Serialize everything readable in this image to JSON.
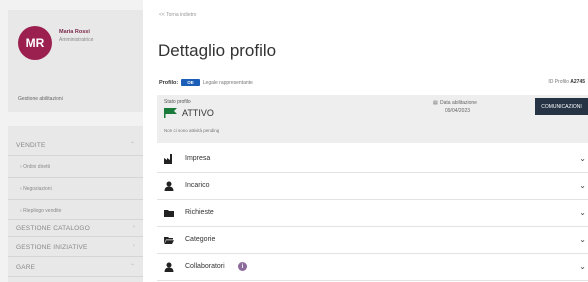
{
  "sidebar": {
    "user": {
      "initials": "MR",
      "name": "Maria Rossi",
      "role": "Amministratrice"
    },
    "card_link": "Gestione abilitazioni",
    "menu": [
      {
        "label": "VENDITE",
        "type": "section",
        "expanded": true
      },
      {
        "label": "Ordini diretti",
        "type": "sub"
      },
      {
        "label": "Negoziazioni",
        "type": "sub"
      },
      {
        "label": "Riepilogo vendite",
        "type": "sub"
      },
      {
        "label": "GESTIONE CATALOGO",
        "type": "section",
        "expanded": false
      },
      {
        "label": "GESTIONE INIZIATIVE",
        "type": "section",
        "expanded": false
      },
      {
        "label": "GARE",
        "type": "section",
        "expanded": true
      }
    ]
  },
  "main": {
    "breadcrumb": "<< Torna indietro",
    "title": "Dettaglio profilo",
    "profile_label": "Profilo:",
    "profile_badge": "OE",
    "profile_link": "Legale rappresentante",
    "profile_id_label": "ID Profilo",
    "profile_id_value": "A2745",
    "status": {
      "label": "Stato profilo",
      "value": "ATTIVO",
      "note": "Non ci sono attività pending",
      "enable_label": "Data abilitazione",
      "enable_date": "09/04/2023",
      "button": "COMUNICAZIONI",
      "flag_color": "#1a7a3a"
    },
    "sections": [
      {
        "label": "Impresa",
        "icon": "industry-icon"
      },
      {
        "label": "Incarico",
        "icon": "user-icon"
      },
      {
        "label": "Richieste",
        "icon": "folder-icon"
      },
      {
        "label": "Categorie",
        "icon": "folder-open-icon"
      },
      {
        "label": "Collaboratori",
        "icon": "user-icon",
        "info": "i"
      }
    ]
  },
  "colors": {
    "accent": "#9b1f4f",
    "badge": "#1b5eb8",
    "button": "#253344"
  }
}
